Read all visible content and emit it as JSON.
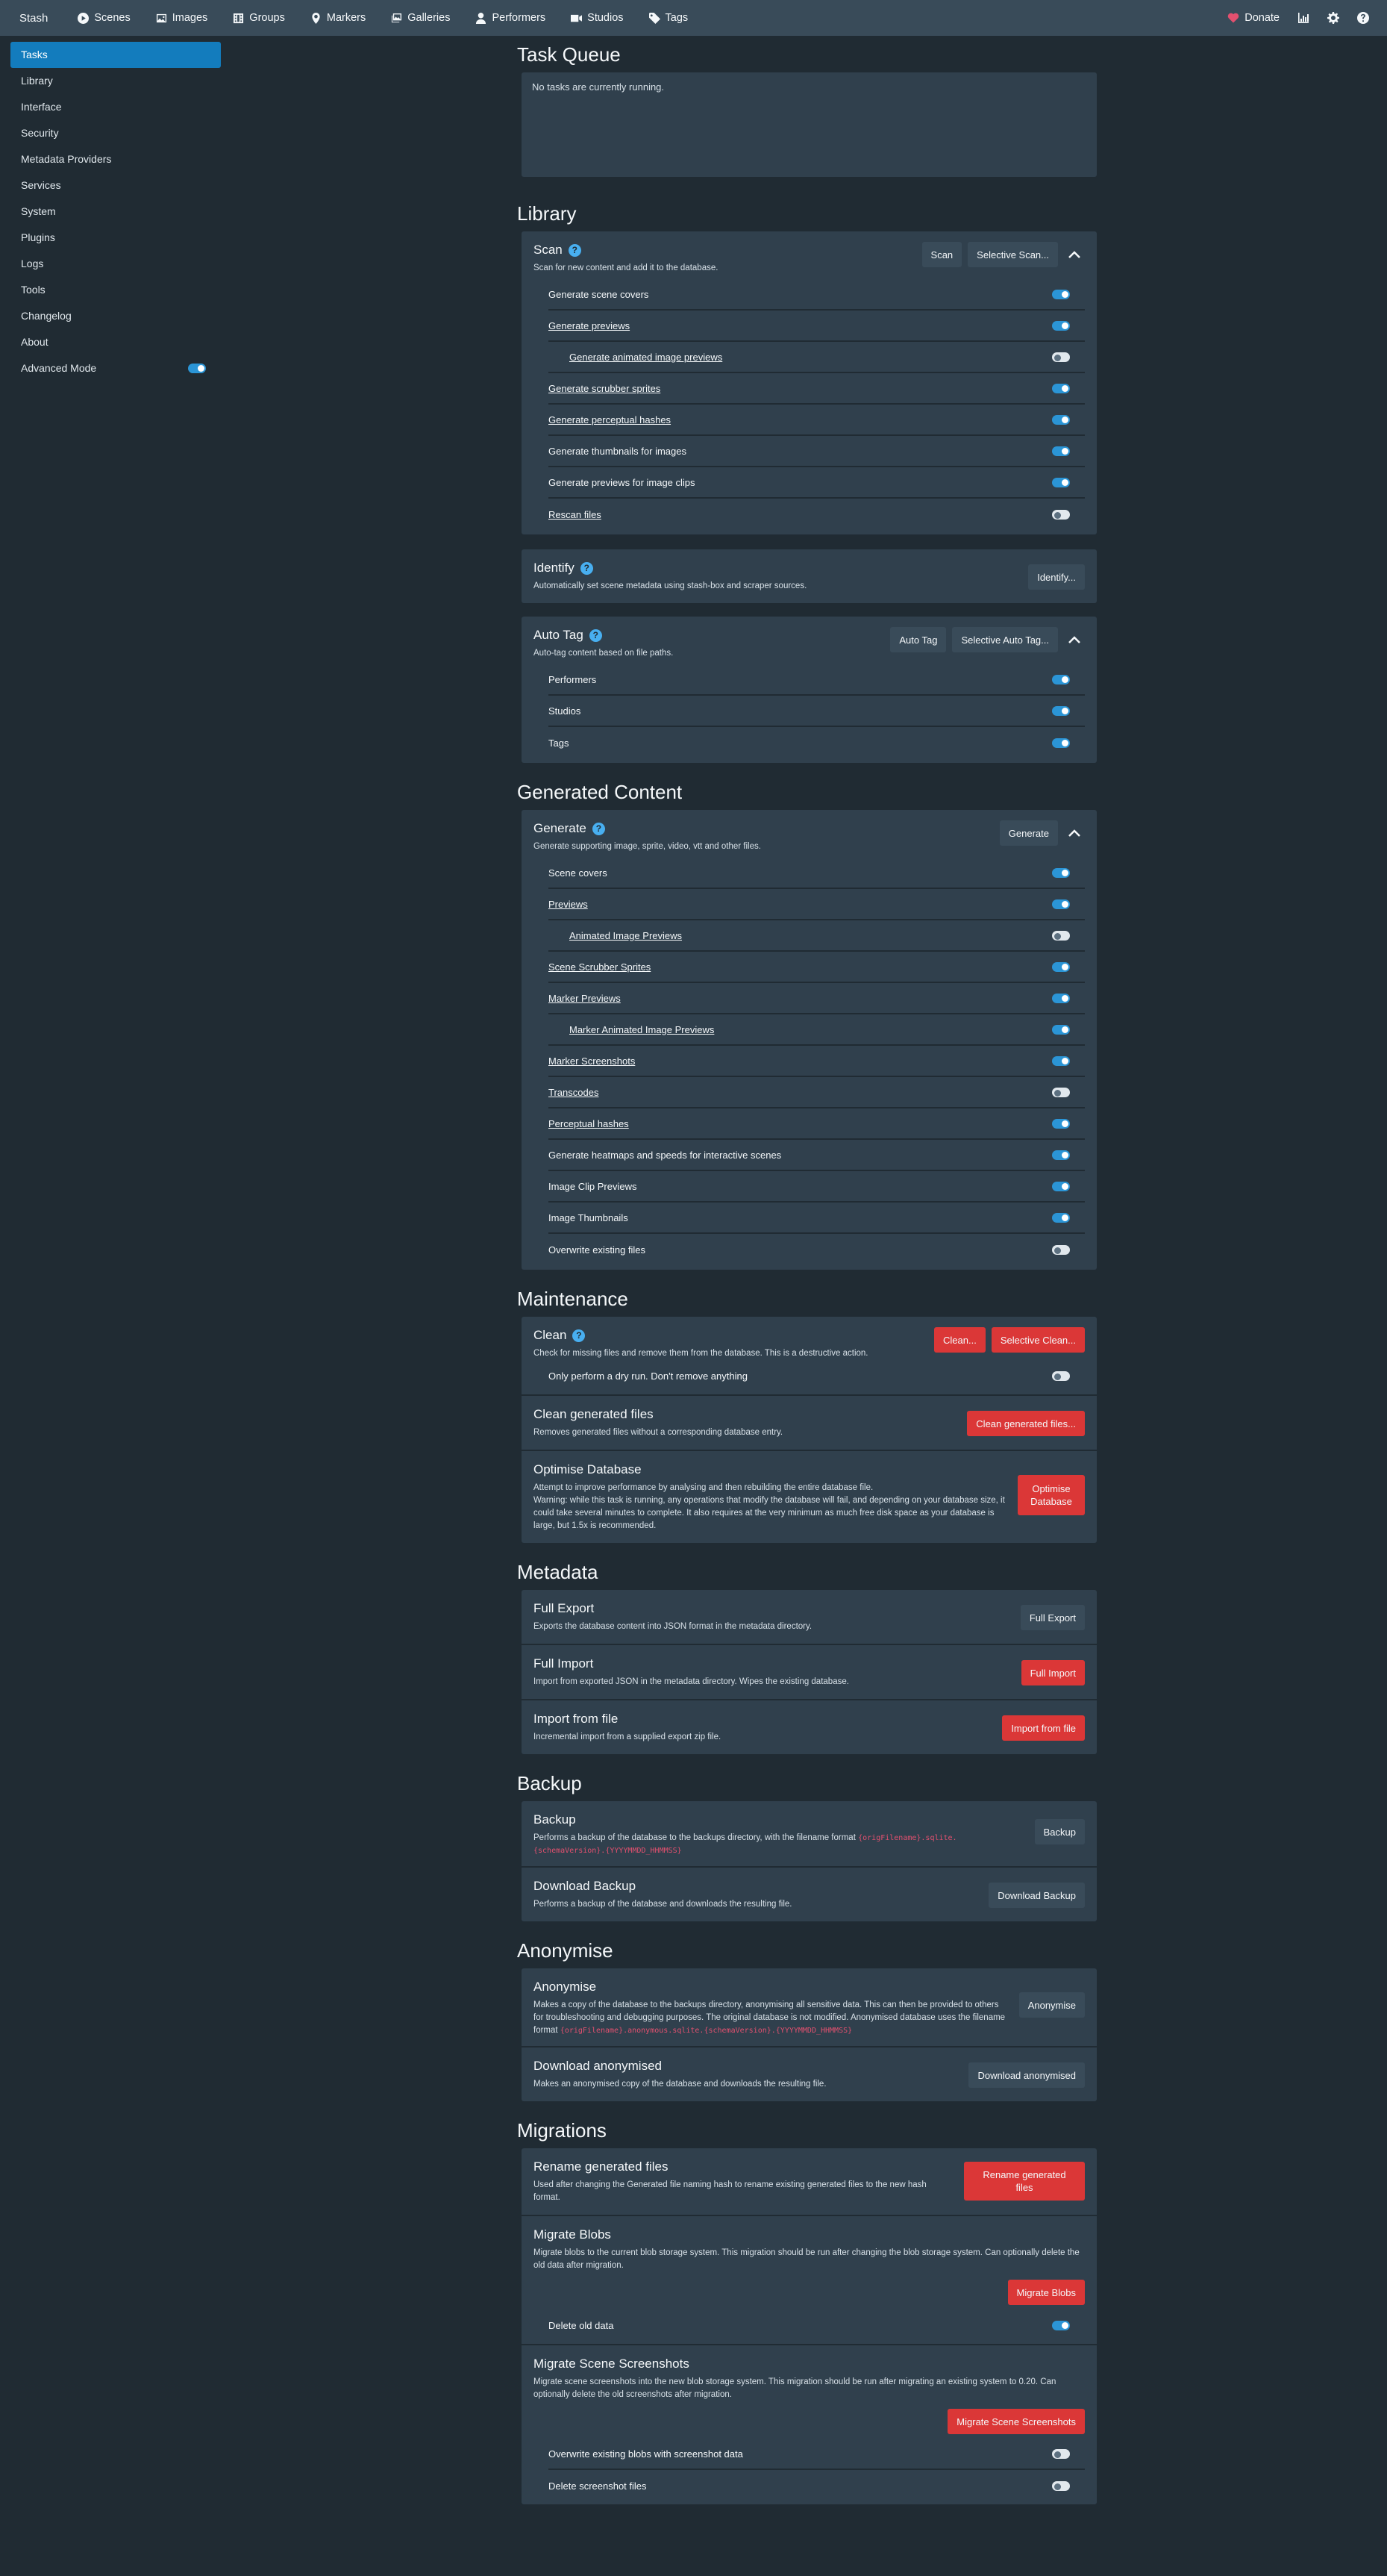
{
  "nav": {
    "brand": "Stash",
    "items": [
      {
        "label": "Scenes",
        "icon": "play-circle-icon"
      },
      {
        "label": "Images",
        "icon": "image-icon"
      },
      {
        "label": "Groups",
        "icon": "film-icon"
      },
      {
        "label": "Markers",
        "icon": "map-marker-icon"
      },
      {
        "label": "Galleries",
        "icon": "images-icon"
      },
      {
        "label": "Performers",
        "icon": "user-icon"
      },
      {
        "label": "Studios",
        "icon": "video-icon"
      },
      {
        "label": "Tags",
        "icon": "tag-icon"
      }
    ],
    "donate": "Donate"
  },
  "sidebar": {
    "items": [
      "Tasks",
      "Library",
      "Interface",
      "Security",
      "Metadata Providers",
      "Services",
      "System",
      "Plugins",
      "Logs",
      "Tools",
      "Changelog",
      "About"
    ],
    "advanced_mode": "Advanced Mode"
  },
  "task_queue": {
    "title": "Task Queue",
    "empty": "No tasks are currently running."
  },
  "library": {
    "title": "Library",
    "scan": {
      "title": "Scan",
      "desc": "Scan for new content and add it to the database.",
      "btn_scan": "Scan",
      "btn_selective": "Selective Scan...",
      "options": [
        {
          "label": "Generate scene covers",
          "on": true,
          "u": false,
          "sub": false
        },
        {
          "label": "Generate previews",
          "on": true,
          "u": true,
          "sub": false
        },
        {
          "label": "Generate animated image previews",
          "on": false,
          "u": true,
          "sub": true
        },
        {
          "label": "Generate scrubber sprites",
          "on": true,
          "u": true,
          "sub": false
        },
        {
          "label": "Generate perceptual hashes",
          "on": true,
          "u": true,
          "sub": false
        },
        {
          "label": "Generate thumbnails for images",
          "on": true,
          "u": false,
          "sub": false
        },
        {
          "label": "Generate previews for image clips",
          "on": true,
          "u": false,
          "sub": false
        },
        {
          "label": "Rescan files",
          "on": false,
          "u": true,
          "sub": false
        }
      ]
    },
    "identify": {
      "title": "Identify",
      "desc": "Automatically set scene metadata using stash-box and scraper sources.",
      "btn": "Identify..."
    },
    "autotag": {
      "title": "Auto Tag",
      "desc": "Auto-tag content based on file paths.",
      "btn_auto": "Auto Tag",
      "btn_selective": "Selective Auto Tag...",
      "options": [
        {
          "label": "Performers",
          "on": true,
          "u": false,
          "sub": false
        },
        {
          "label": "Studios",
          "on": true,
          "u": false,
          "sub": false
        },
        {
          "label": "Tags",
          "on": true,
          "u": false,
          "sub": false
        }
      ]
    }
  },
  "generated": {
    "title": "Generated Content",
    "generate": {
      "title": "Generate",
      "desc": "Generate supporting image, sprite, video, vtt and other files.",
      "btn": "Generate",
      "options": [
        {
          "label": "Scene covers",
          "on": true,
          "u": false,
          "sub": false
        },
        {
          "label": "Previews",
          "on": true,
          "u": true,
          "sub": false
        },
        {
          "label": "Animated Image Previews",
          "on": false,
          "u": true,
          "sub": true
        },
        {
          "label": "Scene Scrubber Sprites",
          "on": true,
          "u": true,
          "sub": false
        },
        {
          "label": "Marker Previews",
          "on": true,
          "u": true,
          "sub": false
        },
        {
          "label": "Marker Animated Image Previews",
          "on": true,
          "u": true,
          "sub": true
        },
        {
          "label": "Marker Screenshots",
          "on": true,
          "u": true,
          "sub": false
        },
        {
          "label": "Transcodes",
          "on": false,
          "u": true,
          "sub": false
        },
        {
          "label": "Perceptual hashes",
          "on": true,
          "u": true,
          "sub": false
        },
        {
          "label": "Generate heatmaps and speeds for interactive scenes",
          "on": true,
          "u": false,
          "sub": false
        },
        {
          "label": "Image Clip Previews",
          "on": true,
          "u": false,
          "sub": false
        },
        {
          "label": "Image Thumbnails",
          "on": true,
          "u": false,
          "sub": false
        },
        {
          "label": "Overwrite existing files",
          "on": false,
          "u": false,
          "sub": false
        }
      ]
    }
  },
  "maintenance": {
    "title": "Maintenance",
    "clean": {
      "title": "Clean",
      "desc": "Check for missing files and remove them from the database. This is a destructive action.",
      "btn": "Clean...",
      "btn_selective": "Selective Clean...",
      "dry_run": "Only perform a dry run. Don't remove anything"
    },
    "clean_generated": {
      "title": "Clean generated files",
      "desc": "Removes generated files without a corresponding database entry.",
      "btn": "Clean generated files..."
    },
    "optimise": {
      "title": "Optimise Database",
      "desc1": "Attempt to improve performance by analysing and then rebuilding the entire database file.",
      "desc2": "Warning: while this task is running, any operations that modify the database will fail, and depending on your database size, it could take several minutes to complete. It also requires at the very minimum as much free disk space as your database is large, but 1.5x is recommended.",
      "btn": "Optimise Database"
    }
  },
  "metadata": {
    "title": "Metadata",
    "export": {
      "title": "Full Export",
      "desc": "Exports the database content into JSON format in the metadata directory.",
      "btn": "Full Export"
    },
    "import": {
      "title": "Full Import",
      "desc": "Import from exported JSON in the metadata directory. Wipes the existing database.",
      "btn": "Full Import"
    },
    "import_file": {
      "title": "Import from file",
      "desc": "Incremental import from a supplied export zip file.",
      "btn": "Import from file"
    }
  },
  "backup": {
    "title": "Backup",
    "backup": {
      "title": "Backup",
      "desc": "Performs a backup of the database to the backups directory, with the filename format",
      "code": "{origFilename}.sqlite.{schemaVersion}.{YYYYMMDD_HHMMSS}",
      "btn": "Backup"
    },
    "download": {
      "title": "Download Backup",
      "desc": "Performs a backup of the database and downloads the resulting file.",
      "btn": "Download Backup"
    }
  },
  "anonymise": {
    "title": "Anonymise",
    "anonymise": {
      "title": "Anonymise",
      "desc": "Makes a copy of the database to the backups directory, anonymising all sensitive data. This can then be provided to others for troubleshooting and debugging purposes. The original database is not modified. Anonymised database uses the filename format",
      "code": "{origFilename}.anonymous.sqlite.{schemaVersion}.{YYYYMMDD_HHMMSS}",
      "btn": "Anonymise"
    },
    "download": {
      "title": "Download anonymised",
      "desc": "Makes an anonymised copy of the database and downloads the resulting file.",
      "btn": "Download anonymised"
    }
  },
  "migrations": {
    "title": "Migrations",
    "rename": {
      "title": "Rename generated files",
      "desc": "Used after changing the Generated file naming hash to rename existing generated files to the new hash format.",
      "btn": "Rename generated files"
    },
    "blobs": {
      "title": "Migrate Blobs",
      "desc": "Migrate blobs to the current blob storage system. This migration should be run after changing the blob storage system. Can optionally delete the old data after migration.",
      "btn": "Migrate Blobs",
      "delete_old": "Delete old data"
    },
    "screens": {
      "title": "Migrate Scene Screenshots",
      "desc": "Migrate scene screenshots into the new blob storage system. This migration should be run after migrating an existing system to 0.20. Can optionally delete the old screenshots after migration.",
      "btn": "Migrate Scene Screenshots",
      "overwrite": "Overwrite existing blobs with screenshot data",
      "delete": "Delete screenshot files"
    }
  }
}
